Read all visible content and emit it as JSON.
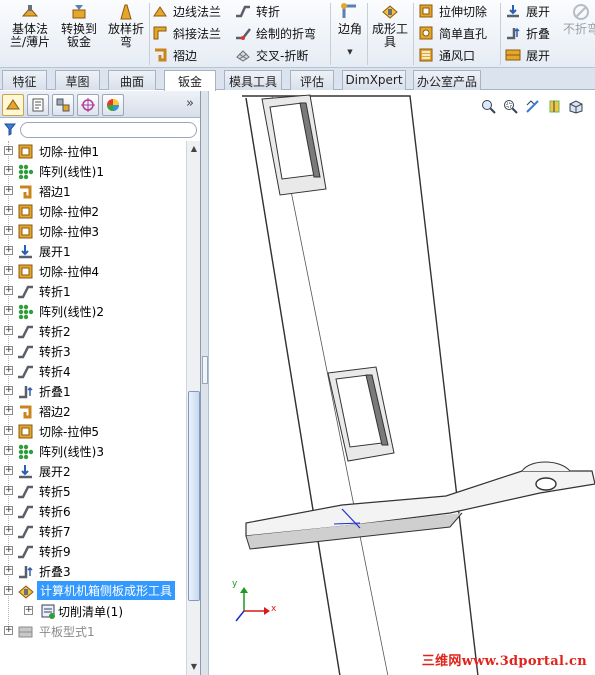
{
  "ribbon": {
    "base_flange": "基体法兰/薄片",
    "convert_to_sheetmetal": "转换到钣金",
    "lofted_bend": "放样折弯",
    "edge_flange": "边线法兰",
    "miter_flange": "斜接法兰",
    "hem": "褶边",
    "jog": "转折",
    "sketched_bend": "绘制的折弯",
    "cross_break": "交叉-折断",
    "corner": "边角",
    "forming_tool": "成形工具",
    "extruded_cut": "拉伸切除",
    "simple_hole": "简单直孔",
    "vent": "通风口",
    "unfold": "展开",
    "fold": "折叠",
    "flatten": "展开",
    "no_bends": "不折弯"
  },
  "tabs": [
    {
      "label": "特征"
    },
    {
      "label": "草图"
    },
    {
      "label": "曲面"
    },
    {
      "label": "钣金"
    },
    {
      "label": "模具工具"
    },
    {
      "label": "评估"
    },
    {
      "label": "DimXpert"
    },
    {
      "label": "办公室产品"
    }
  ],
  "panel": {
    "more": "»"
  },
  "tree": {
    "items": [
      {
        "label": "切除-拉伸1",
        "icon": "extruded-cut-icon"
      },
      {
        "label": "阵列(线性)1",
        "icon": "linear-pattern-icon"
      },
      {
        "label": "褶边1",
        "icon": "hem-icon"
      },
      {
        "label": "切除-拉伸2",
        "icon": "extruded-cut-icon"
      },
      {
        "label": "切除-拉伸3",
        "icon": "extruded-cut-icon"
      },
      {
        "label": "展开1",
        "icon": "unfold-icon"
      },
      {
        "label": "切除-拉伸4",
        "icon": "extruded-cut-icon"
      },
      {
        "label": "转折1",
        "icon": "jog-icon"
      },
      {
        "label": "阵列(线性)2",
        "icon": "linear-pattern-icon"
      },
      {
        "label": "转折2",
        "icon": "jog-icon"
      },
      {
        "label": "转折3",
        "icon": "jog-icon"
      },
      {
        "label": "转折4",
        "icon": "jog-icon"
      },
      {
        "label": "折叠1",
        "icon": "fold-icon"
      },
      {
        "label": "褶边2",
        "icon": "hem-icon"
      },
      {
        "label": "切除-拉伸5",
        "icon": "extruded-cut-icon"
      },
      {
        "label": "阵列(线性)3",
        "icon": "linear-pattern-icon"
      },
      {
        "label": "展开2",
        "icon": "unfold-icon"
      },
      {
        "label": "转折5",
        "icon": "jog-icon"
      },
      {
        "label": "转折6",
        "icon": "jog-icon"
      },
      {
        "label": "转折7",
        "icon": "jog-icon"
      },
      {
        "label": "转折9",
        "icon": "jog-icon"
      },
      {
        "label": "折叠3",
        "icon": "fold-icon"
      },
      {
        "label": "计算机机箱侧板成形工具",
        "icon": "forming-tool-icon",
        "selected": true
      },
      {
        "label": "切削清单(1)",
        "icon": "cut-list-icon",
        "child": true
      },
      {
        "label": "平板型式1",
        "icon": "flat-pattern-icon",
        "dim": true
      }
    ]
  },
  "axis": {
    "y": "y",
    "x": "x"
  },
  "watermark": "三维网www.3dportal.cn",
  "colors": {
    "selection": "#3399ff",
    "watermark": "#e0241b",
    "tab_bar": "#dbe3ee",
    "scroll_thumb": "#c6d9ef"
  }
}
